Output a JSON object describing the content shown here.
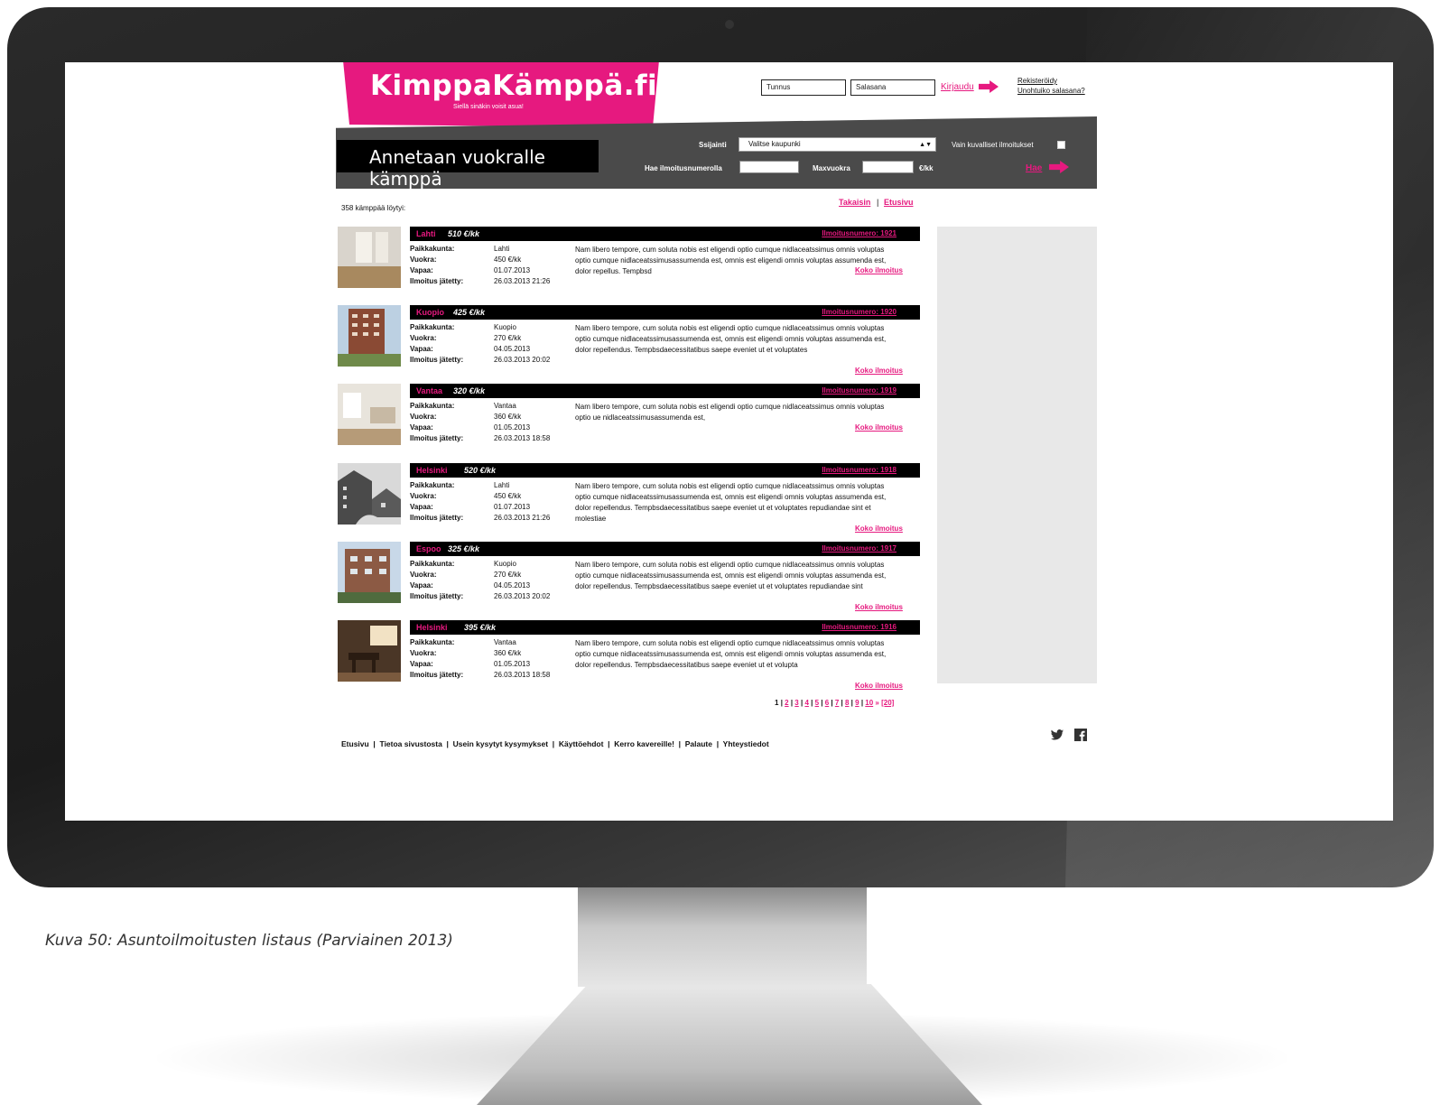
{
  "site": {
    "logo": "KimppaKämppä.fi",
    "tagline": "Siellä sinäkin voisit asua!"
  },
  "login": {
    "username_placeholder": "Tunnus",
    "password_placeholder": "Salasana",
    "login_label": "Kirjaudu",
    "register_label": "Rekisteröidy",
    "forgot_label": "Unohtuiko salasana?"
  },
  "search": {
    "page_title": "Annetaan vuokralle kämppä",
    "location_label": "Ssijainti",
    "location_value": "Valitse kaupunki",
    "only_images_label": "Vain kuvalliset ilmoitukset",
    "number_label": "Hae ilmoitusnumerolla",
    "maxrent_label": "Maxvuokra",
    "unit_label": "€/kk",
    "search_label": "Hae"
  },
  "results": {
    "count_text": "358 kämppää löytyi:",
    "back_label": "Takaisin",
    "separator": "|",
    "home_label": "Etusivu"
  },
  "field_labels": {
    "city": "Paikkakunta:",
    "rent": "Vuokra:",
    "free": "Vapaa:",
    "posted": "Ilmoitus jätetty:",
    "more": "Koko ilmoitus"
  },
  "listings": [
    {
      "title_city": "Lahti",
      "title_price": "510 €/kk",
      "number": "Ilmoitusnumero: 1921",
      "city": "Lahti",
      "rent": "450 €/kk",
      "free": "01.07.2013",
      "posted": "26.03.2013 21:26",
      "desc": "Nam libero tempore, cum soluta nobis est eligendi optio cumque nidlaceatssimus omnis voluptas optio cumque nidlaceatssimusassumenda est, omnis est eligendi omnis voluptas assumenda est, dolor repellus. Tempbsd"
    },
    {
      "title_city": "Kuopio",
      "title_price": "425 €/kk",
      "number": "Ilmoitusnumero: 1920",
      "city": "Kuopio",
      "rent": "270 €/kk",
      "free": "04.05.2013",
      "posted": "26.03.2013 20:02",
      "desc": "Nam libero tempore, cum soluta nobis est eligendi optio cumque nidlaceatssimus omnis voluptas optio cumque nidlaceatssimusassumenda est, omnis est eligendi omnis voluptas assumenda est, dolor repellendus. Tempbsdaecessitatibus saepe eveniet ut et voluptates"
    },
    {
      "title_city": "Vantaa",
      "title_price": "320 €/kk",
      "number": "Ilmoitusnumero: 1919",
      "city": "Vantaa",
      "rent": "360 €/kk",
      "free": "01.05.2013",
      "posted": "26.03.2013 18:58",
      "desc": "Nam libero tempore, cum soluta nobis est eligendi optio cumque nidlaceatssimus omnis voluptas optio ue nidlaceatssimusassumenda est,"
    },
    {
      "title_city": "Helsinki",
      "title_price": "520 €/kk",
      "number": "Ilmoitusnumero: 1918",
      "city": "Lahti",
      "rent": "450 €/kk",
      "free": "01.07.2013",
      "posted": "26.03.2013 21:26",
      "desc": "Nam libero tempore, cum soluta nobis est eligendi optio cumque nidlaceatssimus omnis voluptas optio cumque nidlaceatssimusassumenda est, omnis est eligendi omnis voluptas assumenda est, dolor repellendus. Tempbsdaecessitatibus saepe eveniet ut et voluptates repudiandae sint et molestiae"
    },
    {
      "title_city": "Espoo",
      "title_price": "325 €/kk",
      "number": "Ilmoitusnumero: 1917",
      "city": "Kuopio",
      "rent": "270 €/kk",
      "free": "04.05.2013",
      "posted": "26.03.2013 20:02",
      "desc": "Nam libero tempore, cum soluta nobis est eligendi optio cumque nidlaceatssimus omnis voluptas optio cumque nidlaceatssimusassumenda est, omnis est eligendi omnis voluptas assumenda est, dolor repellendus. Tempbsdaecessitatibus saepe eveniet ut et voluptates repudiandae sint"
    },
    {
      "title_city": "Helsinki",
      "title_price": "395 €/kk",
      "number": "Ilmoitusnumero: 1916",
      "city": "Vantaa",
      "rent": "360 €/kk",
      "free": "01.05.2013",
      "posted": "26.03.2013 18:58",
      "desc": "Nam libero tempore, cum soluta nobis est eligendi optio cumque nidlaceatssimus omnis voluptas optio cumque nidlaceatssimusassumenda est, omnis est eligendi omnis voluptas assumenda est, dolor repellendus. Tempbsdaecessitatibus saepe eveniet ut et volupta"
    }
  ],
  "pagination": {
    "current": "1",
    "pages": [
      "2",
      "3",
      "4",
      "5",
      "6",
      "7",
      "8",
      "9",
      "10"
    ],
    "next": "»",
    "last": "[20]"
  },
  "footer": {
    "links": [
      "Etusivu",
      "Tietoa sivustosta",
      "Usein kysytyt kysymykset",
      "Käyttöehdot",
      "Kerro kavereille!",
      "Palaute",
      "Yhteystiedot"
    ]
  },
  "caption": "Kuva 50: Asuntoilmoitusten listaus (Parviainen 2013)",
  "colors": {
    "brand": "#e6197f",
    "bar": "#000000",
    "searchbar": "#4a4a4a",
    "panel": "#e8e8e8"
  },
  "icons": [
    "arrow-right-icon",
    "twitter-icon",
    "facebook-icon",
    "building-placeholder-icon"
  ]
}
